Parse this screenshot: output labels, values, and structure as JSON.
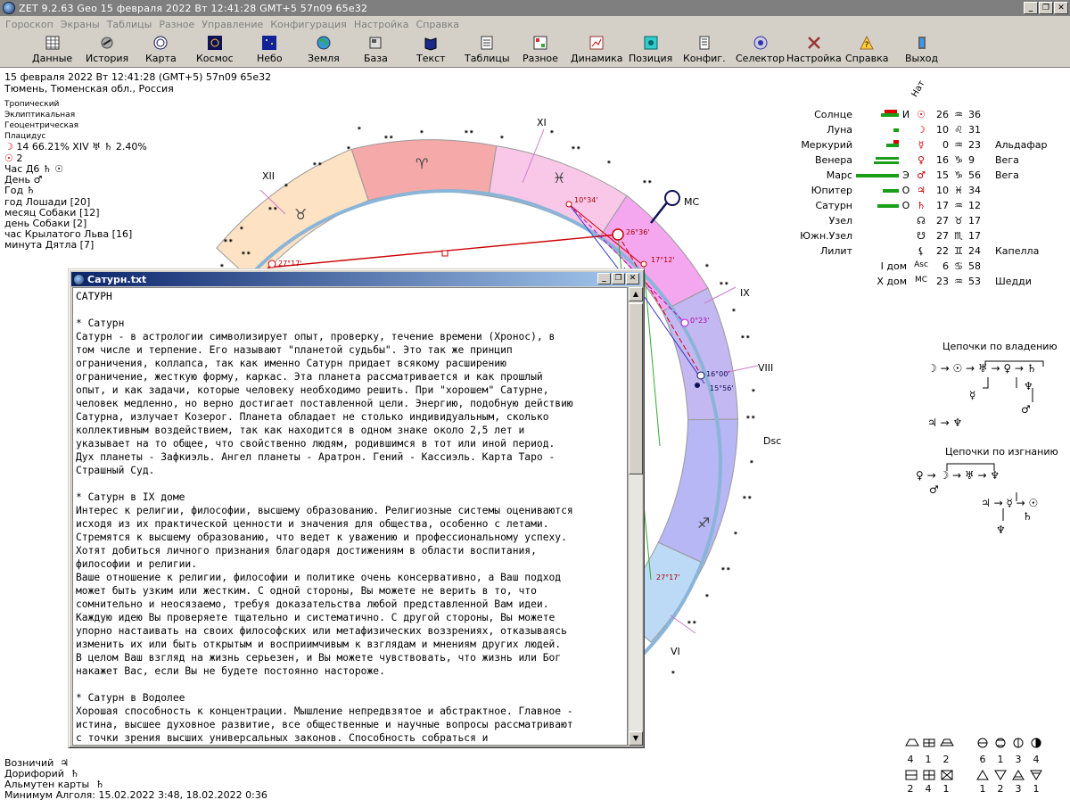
{
  "window": {
    "title": "ZET 9.2.63 Geo   15 февраля 2022  Вт  12:41:28 GMT+5 57n09  65e32",
    "controls": [
      "_",
      "❐",
      "✕"
    ]
  },
  "menu": [
    "Гороскоп",
    "Экраны",
    "Таблицы",
    "Разное",
    "Управление",
    "Конфигурация",
    "Настройка",
    "Справка"
  ],
  "toolbar": [
    {
      "label": "Данные",
      "icon": "table-icon"
    },
    {
      "label": "История",
      "icon": "history-icon"
    },
    {
      "label": "Карта",
      "icon": "chart-wheel-icon"
    },
    {
      "label": "Космос",
      "icon": "cosmos-icon"
    },
    {
      "label": "Небо",
      "icon": "sky-icon"
    },
    {
      "label": "Земля",
      "icon": "earth-icon"
    },
    {
      "label": "База",
      "icon": "database-icon"
    },
    {
      "label": "Текст",
      "icon": "book-icon"
    },
    {
      "label": "Таблицы",
      "icon": "tables-icon"
    },
    {
      "label": "Разное",
      "icon": "misc-icon"
    },
    {
      "label": "Динамика",
      "icon": "dynamics-icon"
    },
    {
      "label": "Позиция",
      "icon": "position-icon"
    },
    {
      "label": "Конфиг.",
      "icon": "config-icon"
    },
    {
      "label": "Селектор",
      "icon": "selector-icon"
    },
    {
      "label": "Настройка",
      "icon": "tools-icon"
    },
    {
      "label": "Справка",
      "icon": "help-icon"
    },
    {
      "label": "Выход",
      "icon": "exit-icon"
    }
  ],
  "info": {
    "datetime": "15 февраля 2022  Вт  12:41:28 (GMT+5) 57n09  65e32",
    "place": "Тюмень, Тюменская обл., Россия",
    "system": [
      "Тропический",
      "Эклиптикальная",
      "Геоцентрическая",
      "Плацидус"
    ],
    "moon_line": "14 66.21% XIV",
    "moon_pct": "2.40%",
    "sun_line": "2",
    "hour_label": "Час Д6",
    "day_label": "День",
    "year_label": "Год",
    "cycles": [
      "год Лошади [20]",
      "месяц Собаки [12]",
      "день Собаки [2]",
      "час Крылатого Льва [16]",
      "минута Дятла [7]"
    ]
  },
  "wheel": {
    "houses": [
      "XI",
      "XII",
      "IX",
      "VIII",
      "VI"
    ],
    "mc": "MC",
    "dsc": "Dsc",
    "degree_labels": [
      "27°17'",
      "10°34'",
      "26°36'",
      "17°12'",
      "0°23'",
      "16°00'",
      "15°56'",
      "27°17'"
    ]
  },
  "textwin": {
    "title": "Сатурн.txt",
    "body": "САТУРН\n\n* Сатурн\nСатурн - в астрологии символизирует опыт, проверку, течение времени (Хронос), в\nтом числе и терпение. Его называют \"планетой судьбы\". Это так же принцип\nограничения, коллапса, так как именно Сатурн придает всякому расширению\nограничение, жесткую форму, каркас. Эта планета рассматривается и как прошлый\nопыт, и как задачи, которые человеку необходимо решить. При \"хорошем\" Сатурне,\nчеловек медленно, но верно достигает поставленной цели. Энергию, подобную действию\nСатурна, излучает Козерог. Планета обладает не столько индивидуальным, сколько\nколлективным воздействием, так как находится в одном знаке около 2,5 лет и\nуказывает на то общее, что свойственно людям, родившимся в тот или иной период.\nДух планеты - Зафкиэль. Ангел планеты - Аратрон. Гений - Кассиэль. Карта Таро -\nСтрашный Суд.\n\n* Сатурн в IX доме\nИнтерес к религии, философии, высшему образованию. Религиозные системы оцениваются\nисходя из их практической ценности и значения для общества, особенно с летами.\nСтремятся к высшему образованию, что ведет к уважению и профессиональному успеху.\nХотят добиться личного признания благодаря достижениям в области воспитания,\nфилософии и религии.\nВаше отношение к религии, философии и политике очень консервативно, а Ваш подход\nможет быть узким или жестким. С одной стороны, Вы можете не верить в то, что\nсомнительно и неосязаемо, требуя доказательства любой представленной Вам идеи.\nКаждую идею Вы проверяете тщательно и систематично. С другой стороны, Вы можете\nупорно настаивать на своих философских или метафизических воззрениях, отказываясь\nизменить их или быть открытым и восприимчивым к взглядам и мнениям других людей.\nВ целом Ваш взгляд на жизнь серьезен, и Вы можете чувствовать, что жизнь или Бог\nнакажет Вас, если Вы не будете постоянно настороже.\n\n* Сатурн в Водолее\nХорошая способность к концентрации. Мышление непредвзятое и абстрактное. Главное -\nистина, высшее духовное развитие, все общественные и научные вопросы рассматривают\nс точки зрения высших универсальных законов. Способность собраться и"
  },
  "nat_label": "Нат",
  "planets": [
    {
      "name": "Солнце",
      "code": "И",
      "sym": "☉",
      "deg": "26",
      "sign": "♒",
      "min": "36",
      "star": ""
    },
    {
      "name": "Луна",
      "code": "",
      "sym": "☽",
      "deg": "10",
      "sign": "♌",
      "min": "31",
      "star": ""
    },
    {
      "name": "Меркурий",
      "code": "",
      "sym": "☿",
      "deg": "0",
      "sign": "♒",
      "min": "23",
      "star": "Альдафар"
    },
    {
      "name": "Венера",
      "code": "",
      "sym": "♀",
      "deg": "16",
      "sign": "♑",
      "min": "9",
      "star": "Вега"
    },
    {
      "name": "Марс",
      "code": "Э",
      "sym": "♂",
      "deg": "15",
      "sign": "♑",
      "min": "56",
      "star": "Вега"
    },
    {
      "name": "Юпитер",
      "code": "О",
      "sym": "♃",
      "deg": "10",
      "sign": "♓",
      "min": "34",
      "star": ""
    },
    {
      "name": "Сатурн",
      "code": "О",
      "sym": "♄",
      "deg": "17",
      "sign": "♒",
      "min": "12",
      "star": ""
    },
    {
      "name": "Узел",
      "code": "",
      "sym": "☊",
      "deg": "27",
      "sign": "♉",
      "min": "17",
      "star": ""
    },
    {
      "name": "Южн.Узел",
      "code": "",
      "sym": "☋",
      "deg": "27",
      "sign": "♏",
      "min": "17",
      "star": ""
    },
    {
      "name": "Лилит",
      "code": "",
      "sym": "⚸",
      "deg": "22",
      "sign": "♊",
      "min": "24",
      "star": "Капелла"
    },
    {
      "name": "I дом",
      "code": "",
      "sym": "Asc",
      "deg": "6",
      "sign": "♋",
      "min": "58",
      "star": ""
    },
    {
      "name": "X дом",
      "code": "",
      "sym": "MC",
      "deg": "23",
      "sign": "♒",
      "min": "53",
      "star": "Шедди"
    }
  ],
  "chains": {
    "ownership_title": "Цепочки по владению",
    "exile_title": "Цепочки по изгнанию",
    "own_line1": "☽ → ☉ → ♅ → ♀ → ♄",
    "own_mars": "♂",
    "own_merc": "☿",
    "own_nep": "♆",
    "own_line2": "♃ → ♆",
    "ex_line1": "♀ → ☽ → ♅ → ♆",
    "ex_mars": "♂",
    "ex_line2": "♃ → ☿ → ☉",
    "ex_sat": "♄",
    "ex_nep": "♆"
  },
  "footer": {
    "lines": [
      "Возничий",
      "Дорифорий",
      "Альмутен карты",
      "Минимум Алголя: 15.02.2022  3:48,  18.02.2022  0:36"
    ],
    "glyphs": [
      "♃",
      "♄",
      "♄"
    ]
  },
  "stats": {
    "top": [
      "4",
      "1",
      "2",
      "6",
      "1",
      "3",
      "4"
    ],
    "bottom": [
      "2",
      "4",
      "1",
      "1",
      "2",
      "3",
      "1"
    ]
  }
}
